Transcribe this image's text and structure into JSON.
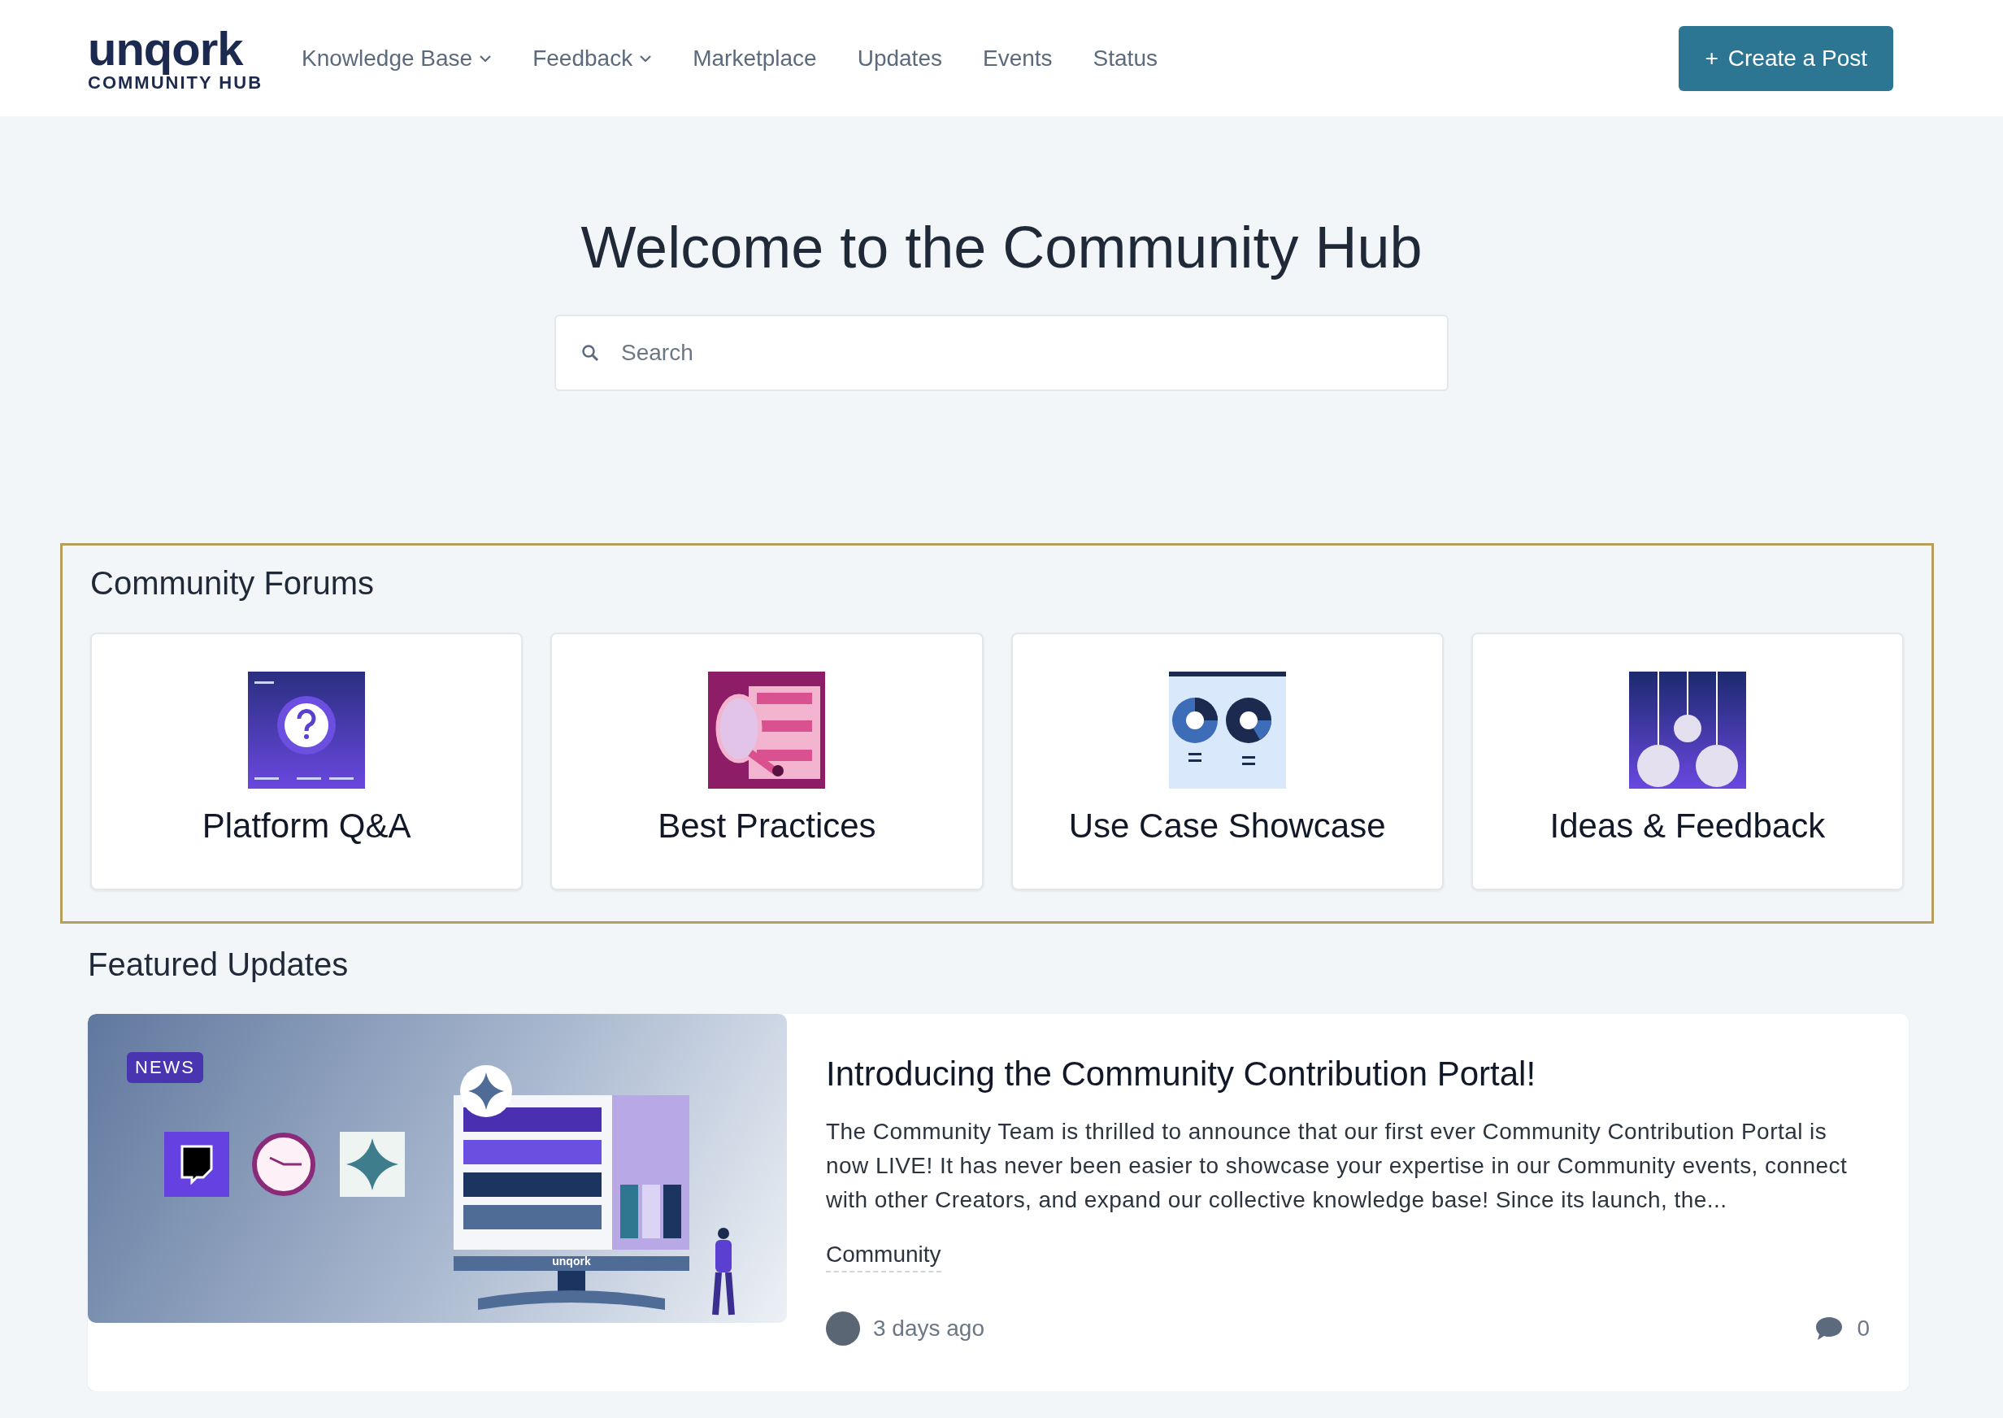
{
  "header": {
    "logo": {
      "wordmark": "unqork",
      "subtitle": "COMMUNITY HUB"
    },
    "nav": [
      {
        "label": "Knowledge Base",
        "dropdown": true
      },
      {
        "label": "Feedback",
        "dropdown": true
      },
      {
        "label": "Marketplace",
        "dropdown": false
      },
      {
        "label": "Updates",
        "dropdown": false
      },
      {
        "label": "Events",
        "dropdown": false
      },
      {
        "label": "Status",
        "dropdown": false
      }
    ],
    "create_button": {
      "icon": "+",
      "label": "Create a Post"
    }
  },
  "hero": {
    "title": "Welcome to the Community Hub",
    "search": {
      "placeholder": "Search"
    }
  },
  "forums": {
    "heading": "Community Forums",
    "cards": [
      {
        "kind": "qa",
        "label": "Platform Q&A"
      },
      {
        "kind": "practices",
        "label": "Best Practices"
      },
      {
        "kind": "showcase",
        "label": "Use Case Showcase"
      },
      {
        "kind": "ideas",
        "label": "Ideas & Feedback"
      }
    ]
  },
  "featured": {
    "heading": "Featured Updates",
    "posts": [
      {
        "badge": "NEWS",
        "monitor_label": "unqork",
        "title": "Introducing the Community Contribution Portal!",
        "excerpt": "The Community Team is thrilled to announce that our first ever Community Contribution Portal is now LIVE! It has never been easier to showcase your expertise in our Community events, connect with other Creators, and expand our collective knowledge base! Since its launch, the...",
        "category": "Community",
        "time": "3 days ago",
        "comments": "0"
      }
    ]
  }
}
